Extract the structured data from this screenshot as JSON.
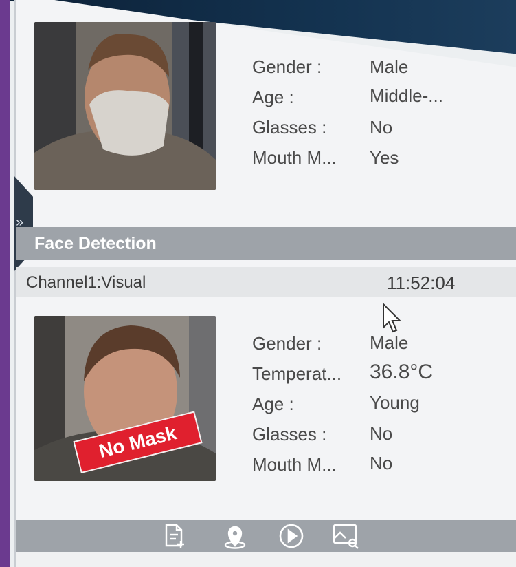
{
  "sidebar": {
    "expand_icon": "double-chevron-right-icon"
  },
  "card1": {
    "attributes": [
      {
        "label": "Gender :",
        "value": "Male"
      },
      {
        "label": "Age :",
        "value": "Middle-..."
      },
      {
        "label": "Glasses :",
        "value": "No"
      },
      {
        "label": "Mouth M...",
        "value": "Yes"
      }
    ]
  },
  "section": {
    "title": "Face Detection"
  },
  "card2": {
    "channel": "Channel1:Visual",
    "time": "11:52:04",
    "badge": "No Mask",
    "attributes": [
      {
        "label": "Gender :",
        "value": "Male"
      },
      {
        "label": "Temperat...",
        "value": "36.8°C"
      },
      {
        "label": "Age :",
        "value": "Young"
      },
      {
        "label": "Glasses :",
        "value": "No"
      },
      {
        "label": "Mouth M...",
        "value": "No"
      }
    ]
  },
  "toolbar": {
    "icons": [
      "add-document-icon",
      "location-icon",
      "play-icon",
      "image-search-icon"
    ]
  },
  "colors": {
    "accent_purple": "#6b3a8f",
    "mask_badge_red": "#e0202e",
    "section_bar": "#9ea3a9"
  }
}
